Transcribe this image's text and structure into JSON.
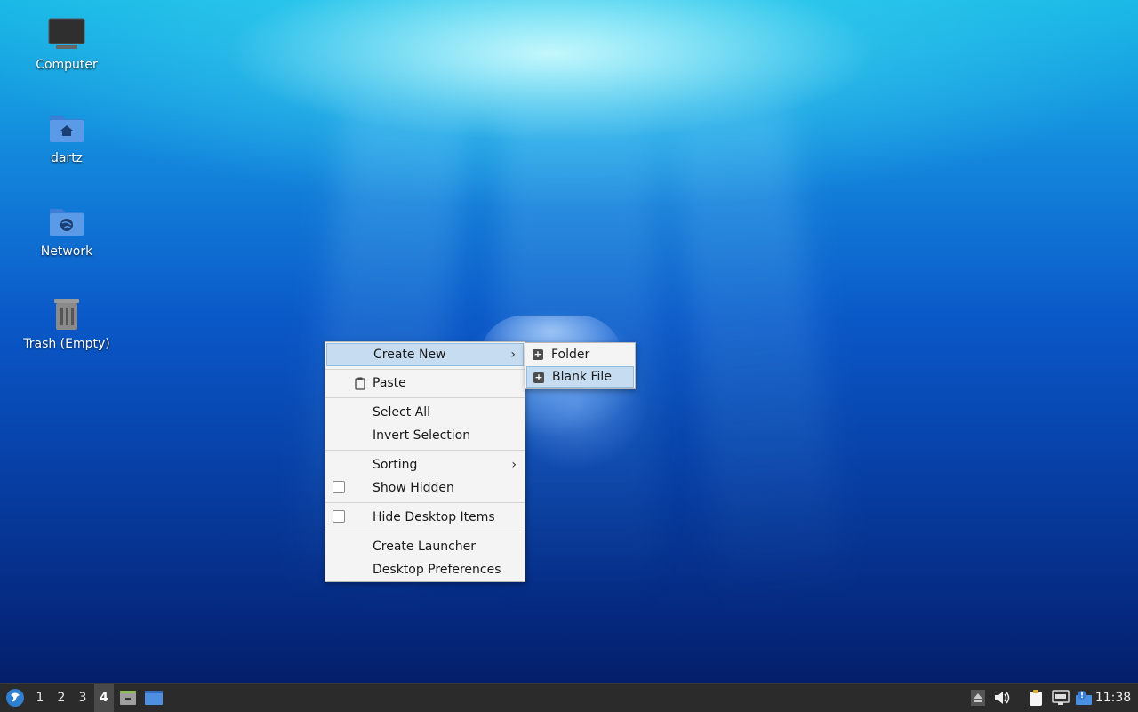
{
  "desktop": {
    "icons": [
      {
        "label": "Computer"
      },
      {
        "label": "dartz"
      },
      {
        "label": "Network"
      },
      {
        "label": "Trash (Empty)"
      }
    ]
  },
  "context_menu": {
    "create_new": "Create New",
    "paste": "Paste",
    "select_all": "Select All",
    "invert_selection": "Invert Selection",
    "sorting": "Sorting",
    "show_hidden": "Show Hidden",
    "hide_desktop_items": "Hide Desktop Items",
    "create_launcher": "Create Launcher",
    "desktop_preferences": "Desktop Preferences",
    "submenu_arrow": "›"
  },
  "submenu": {
    "folder": "Folder",
    "blank_file": "Blank File"
  },
  "taskbar": {
    "workspaces": [
      "1",
      "2",
      "3",
      "4"
    ],
    "active_workspace": "4",
    "clock": "11:38",
    "icons": [
      "lxqt-start-icon",
      "file-manager-icon",
      "show-desktop-icon",
      "eject-icon",
      "volume-icon",
      "clipboard-icon",
      "network-icon",
      "update-notifier-icon"
    ]
  },
  "colors": {
    "menu_bg": "#f4f4f4",
    "menu_highlight": "#c6dcf0",
    "taskbar_bg": "#2b2b2b",
    "folder_blue": "#4f8fe0"
  }
}
